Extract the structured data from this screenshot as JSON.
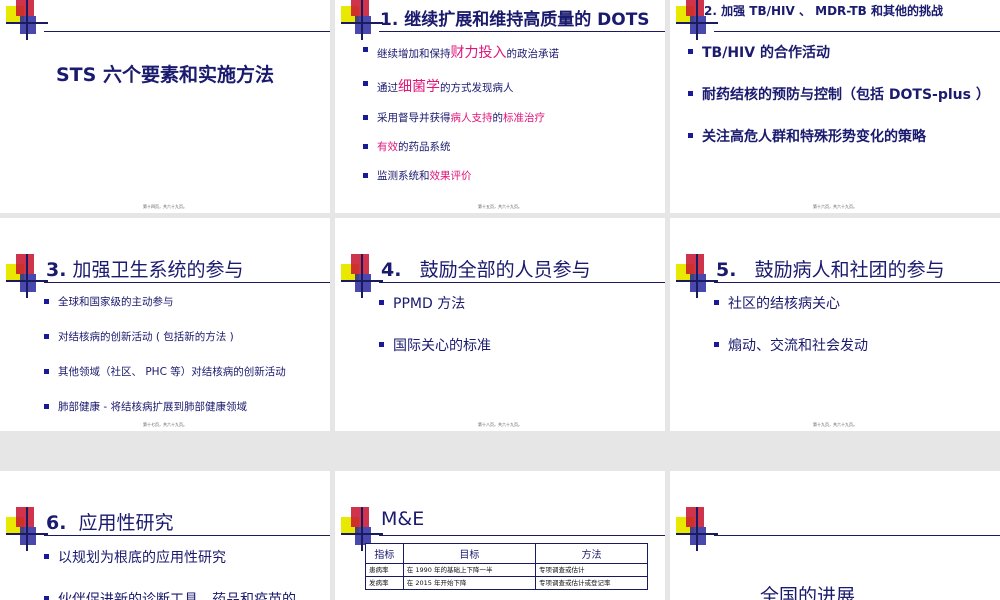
{
  "slides": {
    "s1": {
      "title": "STS 六个要素和实施方法",
      "footer": "第十四页，共六十九页。"
    },
    "s2": {
      "title_num": "1.",
      "title_text": "继续扩展和维持高质量的 DOTS",
      "items": [
        {
          "pre": "继续增加和保持",
          "hl": "财力投入",
          "post": "的政治承诺"
        },
        {
          "pre": "通过",
          "hl": "细菌学",
          "post": "的方式发现病人"
        },
        {
          "pre": "采用督导并获得",
          "hl": "病人支持",
          "post": "的",
          "hl2": "标准治疗"
        },
        {
          "pre": "",
          "hl": "有效",
          "post": "的药品系统"
        },
        {
          "pre": "监测系统和",
          "hl": "效果评价",
          "post": ""
        }
      ],
      "footer": "第十五页，共六十九页。"
    },
    "s3": {
      "title": "2. 加强 TB/HIV 、 MDR-TB 和其他的挑战",
      "items": [
        "TB/HIV 的合作活动",
        "耐药结核的预防与控制（包括 DOTS-plus ）",
        "关注高危人群和特殊形势变化的策略"
      ],
      "footer": "第十六页，共六十九页。"
    },
    "s4": {
      "title_num": "3.",
      "title_text": "加强卫生系统的参与",
      "items": [
        "全球和国家级的主动参与",
        "对结核病的创新活动 ( 包括新的方法 )",
        "其他领域（社区、 PHC 等）对结核病的创新活动",
        "肺部健康 - 将结核病扩展到肺部健康领域"
      ],
      "footer": "第十七页，共六十九页。"
    },
    "s5": {
      "title_num": "4.",
      "title_text": "鼓励全部的人员参与",
      "items": [
        "PPMD 方法",
        "国际关心的标准"
      ],
      "footer": "第十八页，共六十九页。"
    },
    "s6": {
      "title_num": "5.",
      "title_text": "鼓励病人和社团的参与",
      "items": [
        "社区的结核病关心",
        "煽动、交流和社会发动"
      ],
      "footer": "第十九页，共六十九页。"
    },
    "s7": {
      "title_num": "6.",
      "title_text": "应用性研究",
      "items": [
        "以规划为根底的应用性研究",
        "伙伴促进新的诊断工具、药品和疫苗的"
      ]
    },
    "s8": {
      "title": "M&E",
      "headers": [
        "指标",
        "目标",
        "方法"
      ],
      "rows": [
        [
          "患病率",
          "在 1990 年的基础上下降一半",
          "专项调查或估计"
        ],
        [
          "发病率",
          "在 2015 年开始下降",
          "专项调查或估计或登记率"
        ]
      ]
    },
    "s9": {
      "title": "全国的进展"
    }
  }
}
